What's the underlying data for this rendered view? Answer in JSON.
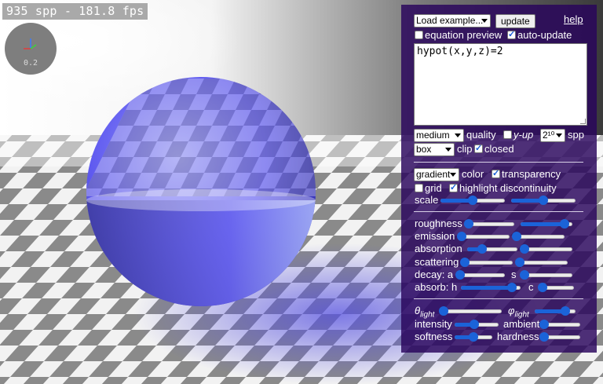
{
  "overlay": {
    "stats": "935 spp - 181.8 fps",
    "axes_scale": "0.2"
  },
  "panel": {
    "example_select": "Load example...",
    "update_button": "update",
    "help_link": "help",
    "equation_preview_label": "equation preview",
    "equation_preview_checked": false,
    "auto_update_label": "auto-update",
    "auto_update_checked": true,
    "equation": "hypot(x,y,z)=2",
    "quality_select": "medium",
    "quality_label": "quality",
    "y_up_label": "y-up",
    "y_up_checked": false,
    "spp_select": "2¹⁰",
    "spp_label": "spp",
    "clip_select": "box",
    "clip_label": "clip",
    "closed_label": "closed",
    "closed_checked": true,
    "color_select": "gradient",
    "color_label": "color",
    "transparency_label": "transparency",
    "transparency_checked": true,
    "grid_label": "grid",
    "grid_checked": false,
    "highlight_label": "highlight discontinuity",
    "highlight_checked": true,
    "scale_label": "scale",
    "roughness_label": "roughness",
    "emission_label": "emission",
    "absorption_label": "absorption",
    "scattering_label": "scattering",
    "decay_a_label": "decay: a",
    "decay_s_label": "s",
    "absorb_h_label": "absorb: h",
    "absorb_c_label": "c",
    "theta_label": "θ",
    "theta_sub": "light",
    "phi_label": "φ",
    "phi_sub": "light",
    "intensity_label": "intensity",
    "ambient_label": "ambient",
    "softness_label": "softness",
    "hardness_label": "hardness"
  },
  "sliders": {
    "scale_1": 0.5,
    "scale_2": 0.5,
    "roughness_1": 0.1,
    "roughness_2": 0.85,
    "emission_1": 0.05,
    "emission_2": 0.05,
    "absorption_1": 0.3,
    "absorption_2": 0.05,
    "scattering_1": 0.05,
    "scattering_2": 0.05,
    "decay_a": 0.05,
    "decay_s": 0.05,
    "absorb_h": 0.85,
    "absorb_c": 0.05,
    "theta_light": 0.05,
    "phi_light": 0.75,
    "intensity": 0.45,
    "ambient": 0.05,
    "softness": 0.5,
    "hardness": 0.05
  },
  "colors": {
    "panel_bg": "#28045c",
    "accent": "#1b63d8",
    "sphere": "#5a55e8"
  }
}
